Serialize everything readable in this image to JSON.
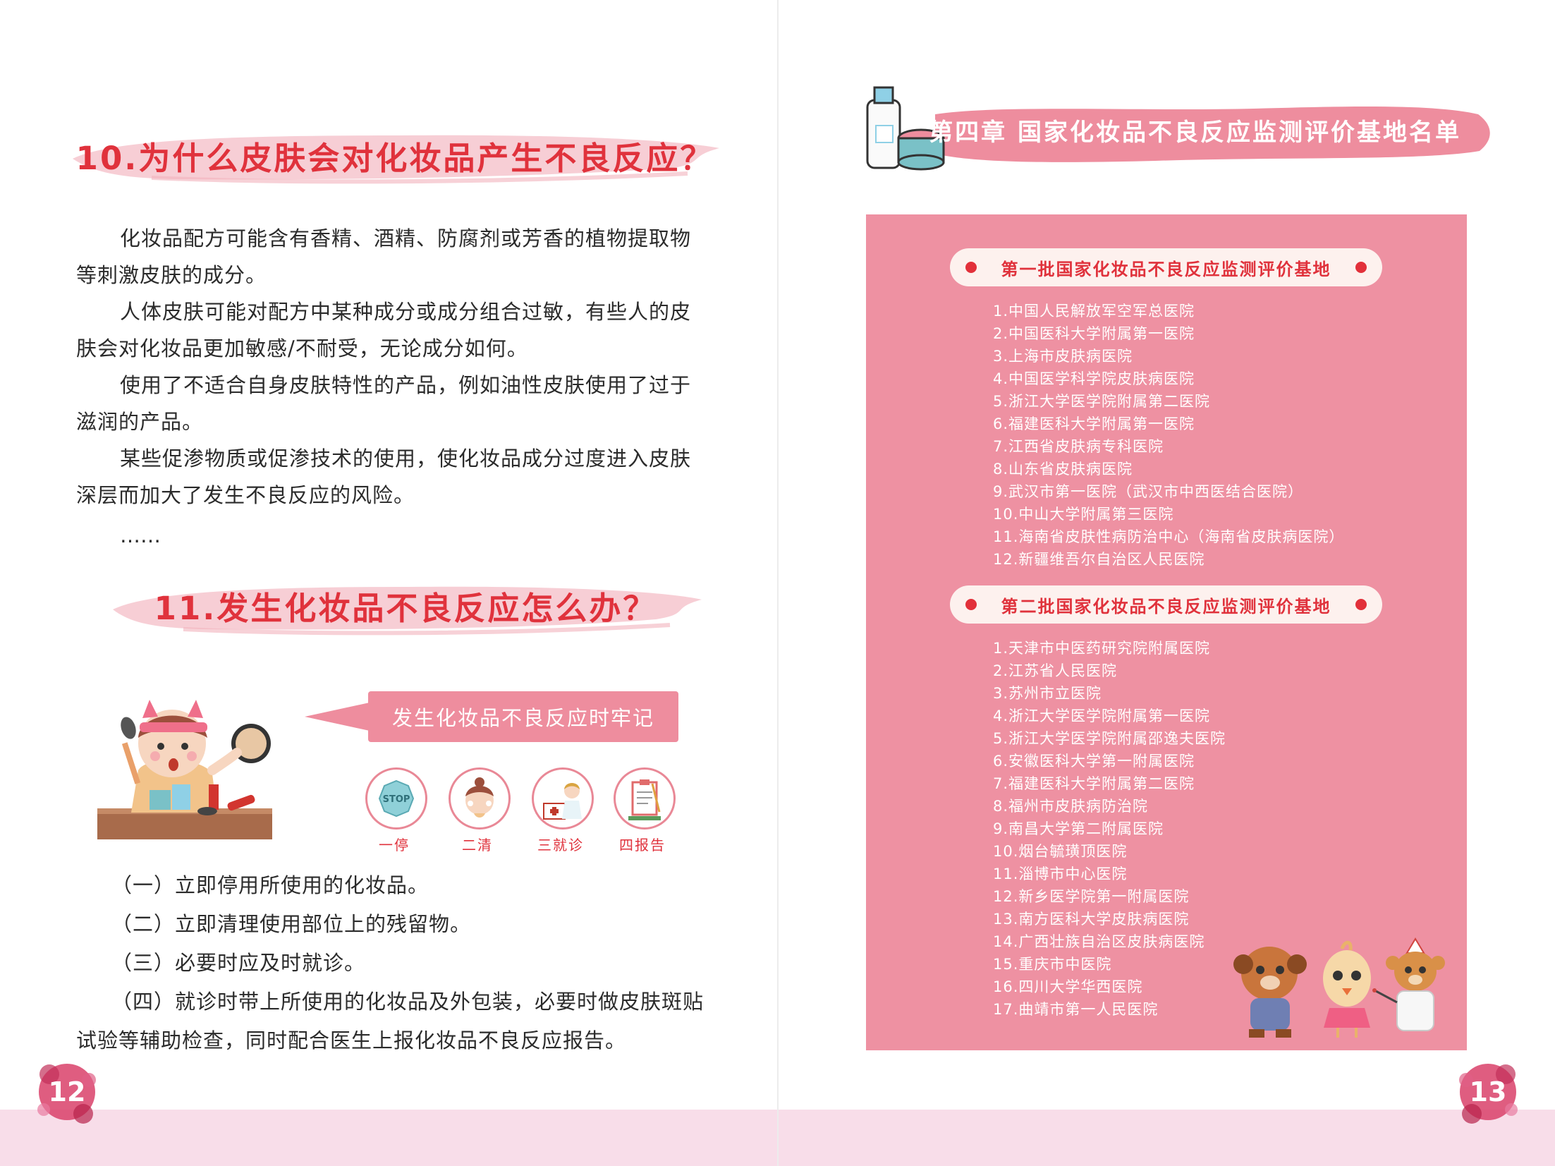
{
  "left_page": {
    "heading_10": "10.为什么皮肤会对化妆品产生不良反应？",
    "paragraphs": [
      "化妆品配方可能含有香精、酒精、防腐剂或芳香的植物提取物等刺激皮肤的成分。",
      "人体皮肤可能对配方中某种成分或成分组合过敏，有些人的皮肤会对化妆品更加敏感/不耐受，无论成分如何。",
      "使用了不适合自身皮肤特性的产品，例如油性皮肤使用了过于滋润的产品。",
      "某些促渗物质或促渗技术的使用，使化妆品成分过度进入皮肤深层而加大了发生不良反应的风险。"
    ],
    "ellipsis": "……",
    "heading_11": "11.发生化妆品不良反应怎么办？",
    "speech_bubble": "发生化妆品不良反应时牢记",
    "step_labels": [
      "一停",
      "二清",
      "三就诊",
      "四报告"
    ],
    "stop_sign": "STOP",
    "steps": [
      "（一）立即停用所使用的化妆品。",
      "（二）立即清理使用部位上的残留物。",
      "（三）必要时应及时就诊。",
      "（四）就诊时带上所使用的化妆品及外包装，必要时做皮肤斑贴试验等辅助检查，同时配合医生上报化妆品不良反应报告。"
    ],
    "page_number": "12"
  },
  "right_page": {
    "chapter_title": "第四章  国家化妆品不良反应监测评价基地名单",
    "batch_1_title": "第一批国家化妆品不良反应监测评价基地",
    "batch_1": [
      "1.中国人民解放军空军总医院",
      "2.中国医科大学附属第一医院",
      "3.上海市皮肤病医院",
      "4.中国医学科学院皮肤病医院",
      "5.浙江大学医学院附属第二医院",
      "6.福建医科大学附属第一医院",
      "7.江西省皮肤病专科医院",
      "8.山东省皮肤病医院",
      "9.武汉市第一医院（武汉市中西医结合医院）",
      "10.中山大学附属第三医院",
      "11.海南省皮肤性病防治中心（海南省皮肤病医院）",
      "12.新疆维吾尔自治区人民医院"
    ],
    "batch_2_title": "第二批国家化妆品不良反应监测评价基地",
    "batch_2": [
      "1.天津市中医药研究院附属医院",
      "2.江苏省人民医院",
      "3.苏州市立医院",
      "4.浙江大学医学院附属第一医院",
      "5.浙江大学医学院附属邵逸夫医院",
      "6.安徽医科大学第一附属医院",
      "7.福建医科大学附属第二医院",
      "8.福州市皮肤病防治院",
      "9.南昌大学第二附属医院",
      "10.烟台毓璜顶医院",
      "11.淄博市中心医院",
      "12.新乡医学院第一附属医院",
      "13.南方医科大学皮肤病医院",
      "14.广西壮族自治区皮肤病医院",
      "15.重庆市中医院",
      "16.四川大学华西医院",
      "17.曲靖市第一人民医院"
    ],
    "page_number": "13"
  },
  "colors": {
    "accent_red": "#e0323c",
    "panel_pink": "#ee91a2",
    "footer_pink": "#f8dde9",
    "pill_cream": "#fdf1ee"
  }
}
